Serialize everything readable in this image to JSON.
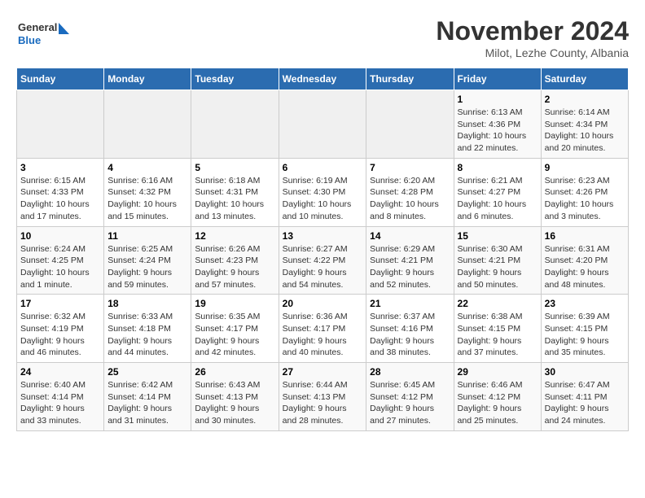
{
  "logo": {
    "general": "General",
    "blue": "Blue"
  },
  "title": "November 2024",
  "subtitle": "Milot, Lezhe County, Albania",
  "days_of_week": [
    "Sunday",
    "Monday",
    "Tuesday",
    "Wednesday",
    "Thursday",
    "Friday",
    "Saturday"
  ],
  "weeks": [
    [
      {
        "day": "",
        "info": ""
      },
      {
        "day": "",
        "info": ""
      },
      {
        "day": "",
        "info": ""
      },
      {
        "day": "",
        "info": ""
      },
      {
        "day": "",
        "info": ""
      },
      {
        "day": "1",
        "info": "Sunrise: 6:13 AM\nSunset: 4:36 PM\nDaylight: 10 hours and 22 minutes."
      },
      {
        "day": "2",
        "info": "Sunrise: 6:14 AM\nSunset: 4:34 PM\nDaylight: 10 hours and 20 minutes."
      }
    ],
    [
      {
        "day": "3",
        "info": "Sunrise: 6:15 AM\nSunset: 4:33 PM\nDaylight: 10 hours and 17 minutes."
      },
      {
        "day": "4",
        "info": "Sunrise: 6:16 AM\nSunset: 4:32 PM\nDaylight: 10 hours and 15 minutes."
      },
      {
        "day": "5",
        "info": "Sunrise: 6:18 AM\nSunset: 4:31 PM\nDaylight: 10 hours and 13 minutes."
      },
      {
        "day": "6",
        "info": "Sunrise: 6:19 AM\nSunset: 4:30 PM\nDaylight: 10 hours and 10 minutes."
      },
      {
        "day": "7",
        "info": "Sunrise: 6:20 AM\nSunset: 4:28 PM\nDaylight: 10 hours and 8 minutes."
      },
      {
        "day": "8",
        "info": "Sunrise: 6:21 AM\nSunset: 4:27 PM\nDaylight: 10 hours and 6 minutes."
      },
      {
        "day": "9",
        "info": "Sunrise: 6:23 AM\nSunset: 4:26 PM\nDaylight: 10 hours and 3 minutes."
      }
    ],
    [
      {
        "day": "10",
        "info": "Sunrise: 6:24 AM\nSunset: 4:25 PM\nDaylight: 10 hours and 1 minute."
      },
      {
        "day": "11",
        "info": "Sunrise: 6:25 AM\nSunset: 4:24 PM\nDaylight: 9 hours and 59 minutes."
      },
      {
        "day": "12",
        "info": "Sunrise: 6:26 AM\nSunset: 4:23 PM\nDaylight: 9 hours and 57 minutes."
      },
      {
        "day": "13",
        "info": "Sunrise: 6:27 AM\nSunset: 4:22 PM\nDaylight: 9 hours and 54 minutes."
      },
      {
        "day": "14",
        "info": "Sunrise: 6:29 AM\nSunset: 4:21 PM\nDaylight: 9 hours and 52 minutes."
      },
      {
        "day": "15",
        "info": "Sunrise: 6:30 AM\nSunset: 4:21 PM\nDaylight: 9 hours and 50 minutes."
      },
      {
        "day": "16",
        "info": "Sunrise: 6:31 AM\nSunset: 4:20 PM\nDaylight: 9 hours and 48 minutes."
      }
    ],
    [
      {
        "day": "17",
        "info": "Sunrise: 6:32 AM\nSunset: 4:19 PM\nDaylight: 9 hours and 46 minutes."
      },
      {
        "day": "18",
        "info": "Sunrise: 6:33 AM\nSunset: 4:18 PM\nDaylight: 9 hours and 44 minutes."
      },
      {
        "day": "19",
        "info": "Sunrise: 6:35 AM\nSunset: 4:17 PM\nDaylight: 9 hours and 42 minutes."
      },
      {
        "day": "20",
        "info": "Sunrise: 6:36 AM\nSunset: 4:17 PM\nDaylight: 9 hours and 40 minutes."
      },
      {
        "day": "21",
        "info": "Sunrise: 6:37 AM\nSunset: 4:16 PM\nDaylight: 9 hours and 38 minutes."
      },
      {
        "day": "22",
        "info": "Sunrise: 6:38 AM\nSunset: 4:15 PM\nDaylight: 9 hours and 37 minutes."
      },
      {
        "day": "23",
        "info": "Sunrise: 6:39 AM\nSunset: 4:15 PM\nDaylight: 9 hours and 35 minutes."
      }
    ],
    [
      {
        "day": "24",
        "info": "Sunrise: 6:40 AM\nSunset: 4:14 PM\nDaylight: 9 hours and 33 minutes."
      },
      {
        "day": "25",
        "info": "Sunrise: 6:42 AM\nSunset: 4:14 PM\nDaylight: 9 hours and 31 minutes."
      },
      {
        "day": "26",
        "info": "Sunrise: 6:43 AM\nSunset: 4:13 PM\nDaylight: 9 hours and 30 minutes."
      },
      {
        "day": "27",
        "info": "Sunrise: 6:44 AM\nSunset: 4:13 PM\nDaylight: 9 hours and 28 minutes."
      },
      {
        "day": "28",
        "info": "Sunrise: 6:45 AM\nSunset: 4:12 PM\nDaylight: 9 hours and 27 minutes."
      },
      {
        "day": "29",
        "info": "Sunrise: 6:46 AM\nSunset: 4:12 PM\nDaylight: 9 hours and 25 minutes."
      },
      {
        "day": "30",
        "info": "Sunrise: 6:47 AM\nSunset: 4:11 PM\nDaylight: 9 hours and 24 minutes."
      }
    ]
  ]
}
